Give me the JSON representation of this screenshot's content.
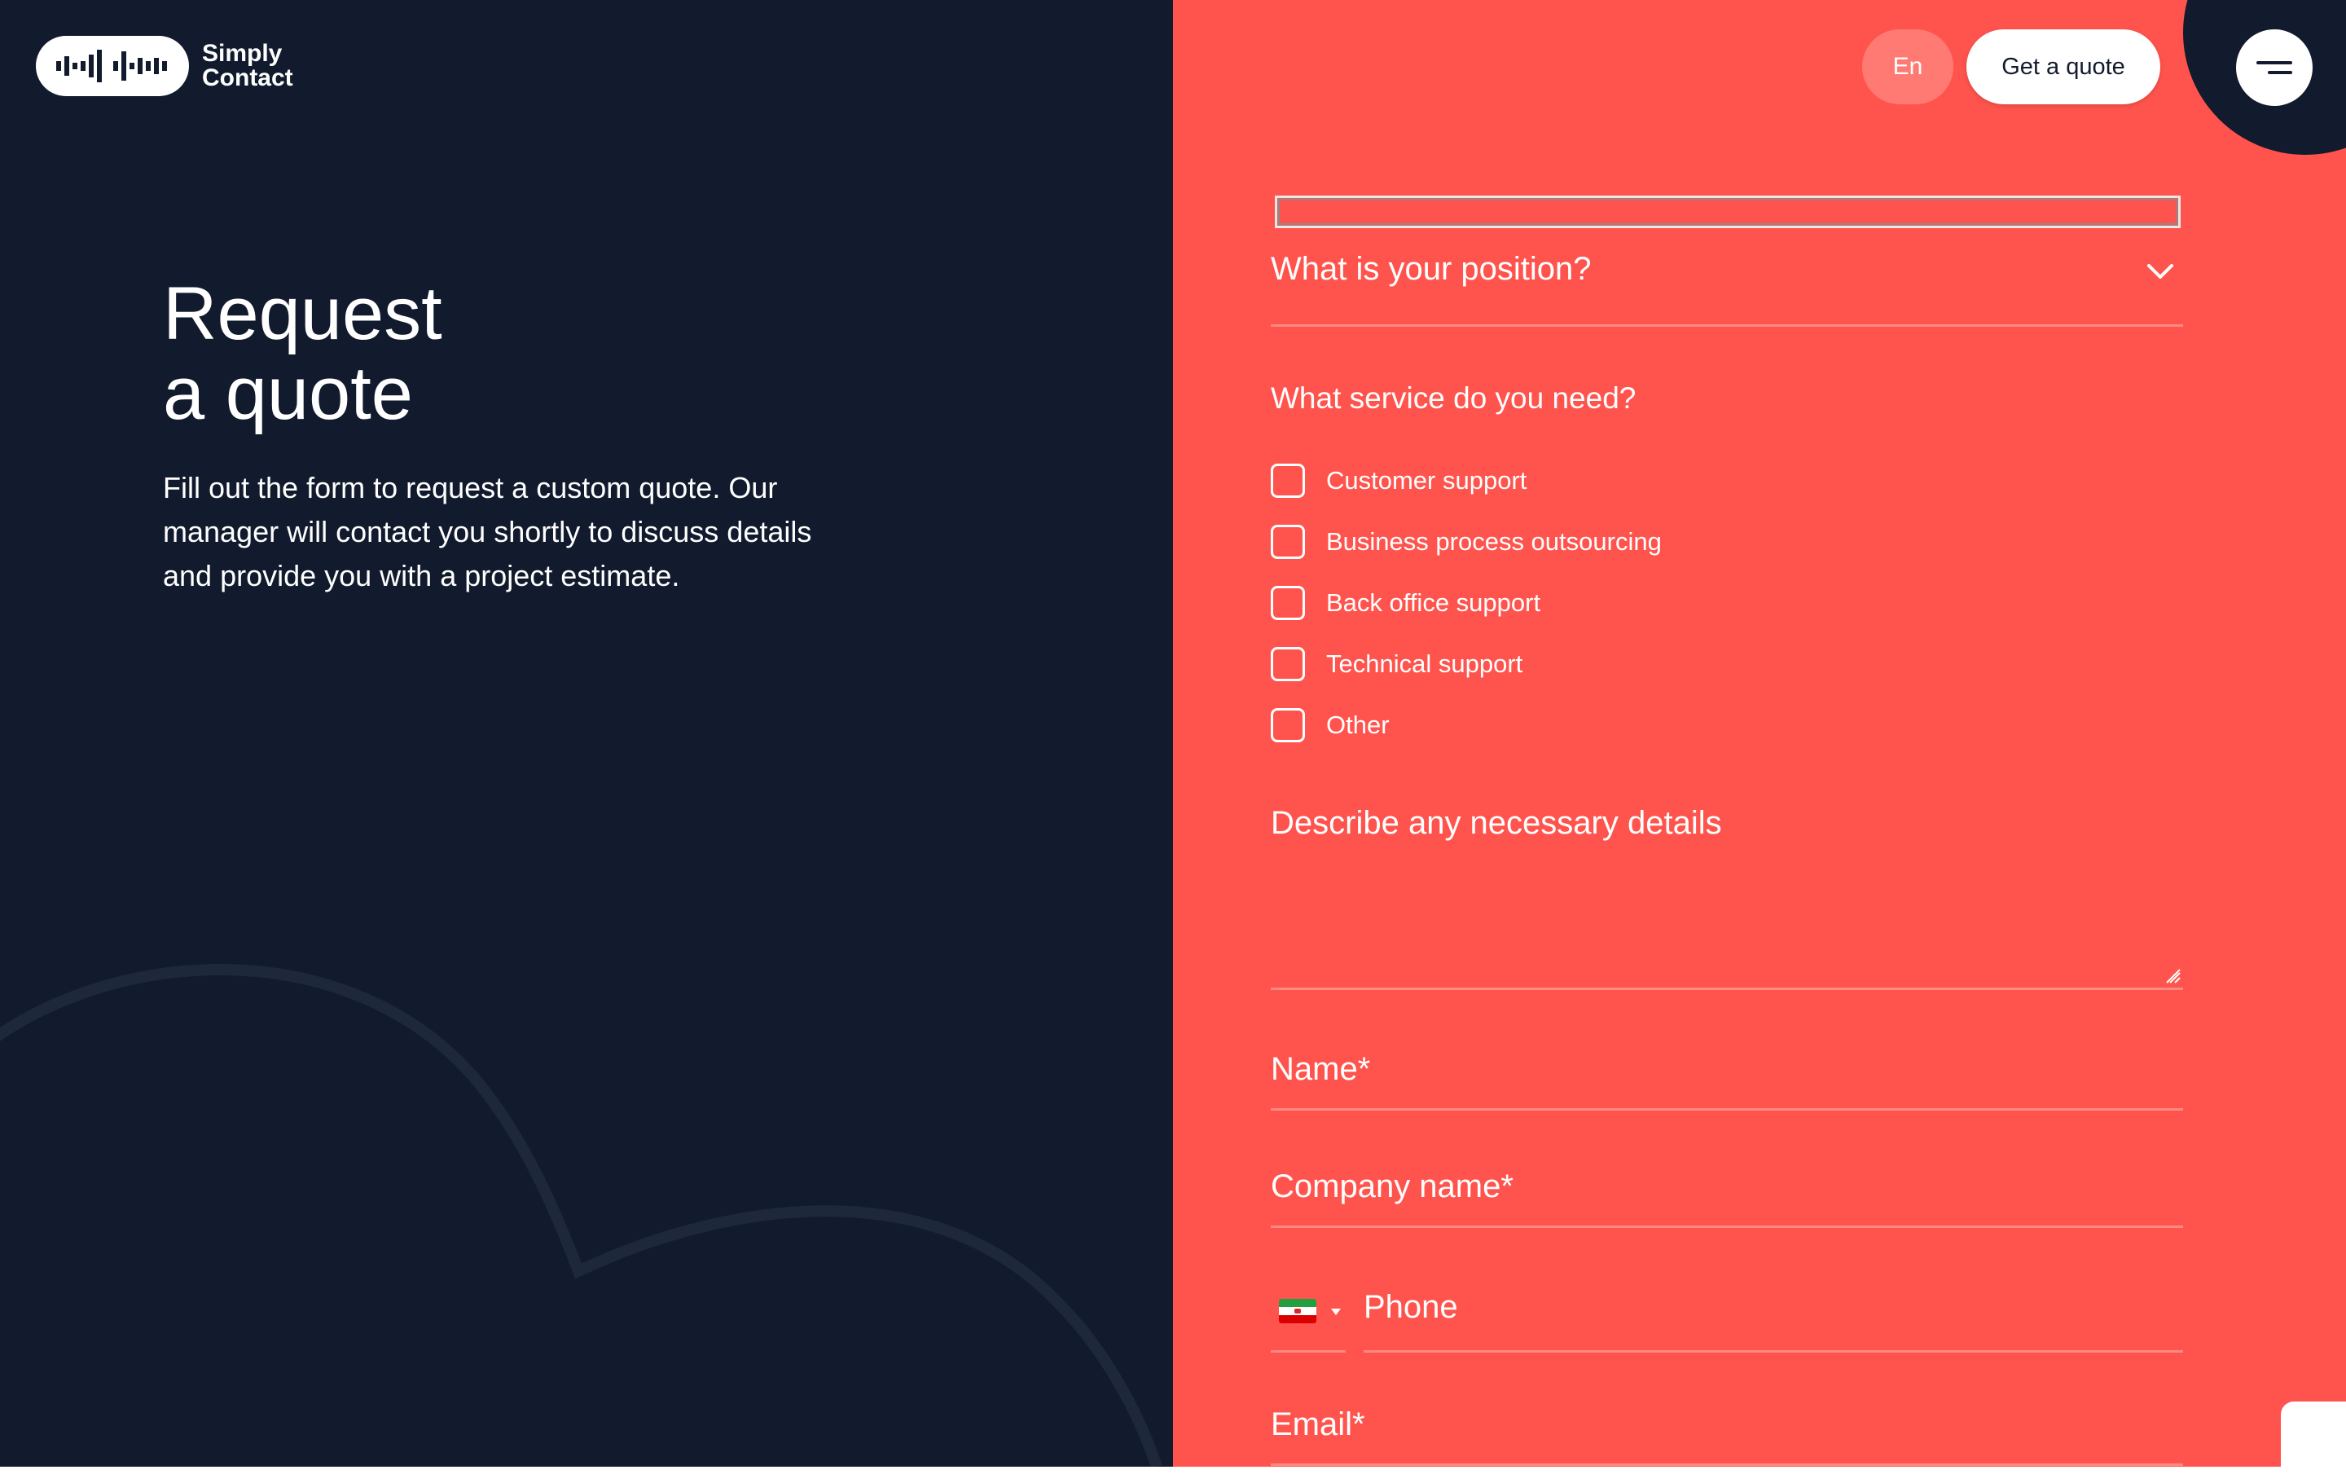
{
  "brand": {
    "line1": "Simply",
    "line2": "Contact"
  },
  "hero": {
    "title_line1": "Request",
    "title_line2": "a quote",
    "description": "Fill out the form to request a custom quote. Our manager will contact you shortly to discuss details and provide you with a project estimate."
  },
  "header": {
    "lang_label": "En",
    "quote_label": "Get a quote"
  },
  "form": {
    "position_label": "What is your position?",
    "service_title": "What service do you need?",
    "services": [
      {
        "label": "Customer support",
        "checked": false
      },
      {
        "label": "Business process outsourcing",
        "checked": false
      },
      {
        "label": "Back office support",
        "checked": false
      },
      {
        "label": "Technical support",
        "checked": false
      },
      {
        "label": "Other",
        "checked": false
      }
    ],
    "details_label": "Describe any necessary details",
    "name_label": "Name*",
    "company_label": "Company name*",
    "phone_label": "Phone",
    "email_label": "Email*"
  },
  "colors": {
    "navy": "#121b2d",
    "coral": "#ff544d",
    "underline": "#ff8a82"
  },
  "icons": [
    "logo-waveform-icon",
    "menu-icon",
    "chevron-down-icon",
    "resize-handle-icon",
    "iran-flag-icon",
    "caret-down-icon"
  ]
}
